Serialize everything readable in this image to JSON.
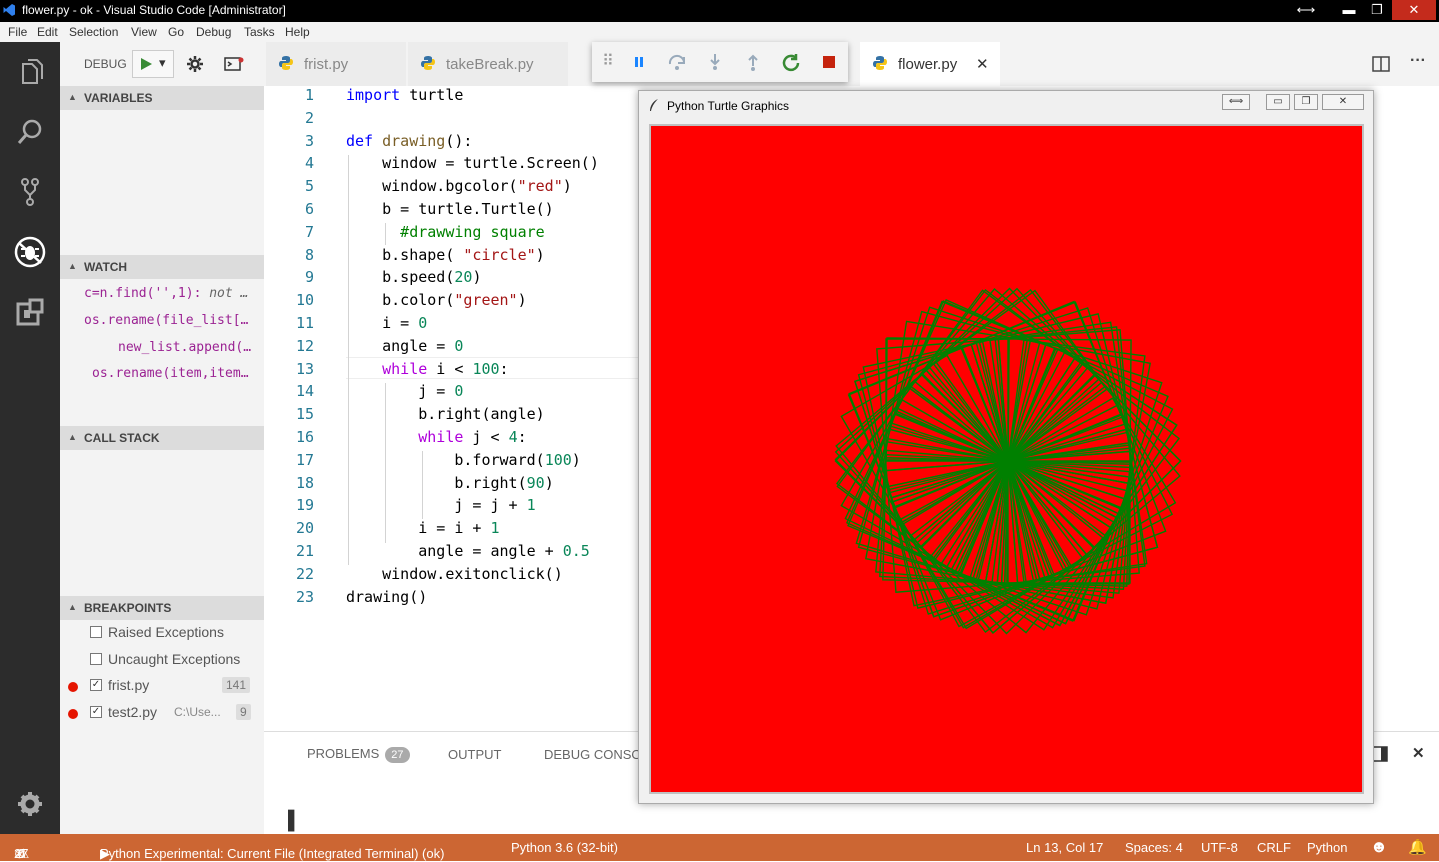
{
  "window": {
    "title": "flower.py - ok - Visual Studio Code [Administrator]",
    "controls": {
      "resize": "⟷",
      "minimize": "▬",
      "maximize": "❐",
      "close": "✕"
    }
  },
  "menu": [
    "File",
    "Edit",
    "Selection",
    "View",
    "Go",
    "Debug",
    "Tasks",
    "Help"
  ],
  "activity_icons": [
    "files-icon",
    "search-icon",
    "source-control-icon",
    "debug-icon",
    "extensions-icon",
    "gear-icon"
  ],
  "debug_header": {
    "label": "DEBUG",
    "config_caret": "▾"
  },
  "sidebar": {
    "variables_title": "VARIABLES",
    "watch_title": "WATCH",
    "watch_items": [
      {
        "expr": "c=n.find('',1): ",
        "value": "not …"
      },
      {
        "expr": "os.rename(file_list[…",
        "value": ""
      },
      {
        "expr": "new_list.append(…",
        "value": ""
      },
      {
        "expr": "os.rename(item,item…",
        "value": ""
      }
    ],
    "callstack_title": "CALL STACK",
    "breakpoints_title": "BREAKPOINTS",
    "breakpoints": [
      {
        "label": "Raised Exceptions",
        "checked": false,
        "dot": false,
        "path": "",
        "line": ""
      },
      {
        "label": "Uncaught Exceptions",
        "checked": false,
        "dot": false,
        "path": "",
        "line": ""
      },
      {
        "label": "frist.py",
        "checked": true,
        "dot": true,
        "path": "",
        "line": "141"
      },
      {
        "label": "test2.py",
        "checked": true,
        "dot": true,
        "path": "C:\\Use...",
        "line": "9"
      }
    ]
  },
  "tabs": [
    {
      "label": "frist.py",
      "active": false
    },
    {
      "label": "takeBreak.py",
      "active": false
    },
    {
      "label": "flower.py",
      "active": true,
      "close": "✕"
    }
  ],
  "editor_actions": {
    "split": "split-editor-icon",
    "more": "···"
  },
  "code_lines": [
    "import turtle",
    "",
    "def drawing():",
    "    window = turtle.Screen()",
    "    window.bgcolor(\"red\")",
    "    b = turtle.Turtle()",
    "      #drawwing square",
    "    b.shape( \"circle\")",
    "    b.speed(20)",
    "    b.color(\"green\")",
    "    i = 0",
    "    angle = 0",
    "    while i < 100:",
    "        j = 0",
    "        b.right(angle)",
    "        while j < 4:",
    "            b.forward(100)",
    "            b.right(90)",
    "            j = j + 1",
    "        i = i + 1",
    "        angle = angle + 0.5",
    "    window.exitonclick()",
    "drawing()"
  ],
  "line_numbers": [
    "1",
    "2",
    "3",
    "4",
    "5",
    "6",
    "7",
    "8",
    "9",
    "10",
    "11",
    "12",
    "13",
    "14",
    "15",
    "16",
    "17",
    "18",
    "19",
    "20",
    "21",
    "22",
    "23"
  ],
  "panel": {
    "tabs": [
      "PROBLEMS",
      "OUTPUT",
      "DEBUG CONSO"
    ],
    "problems_count": "27",
    "cursor": "▌"
  },
  "turtle_window": {
    "title": "Python Turtle Graphics",
    "bgcolor": "#ff0000",
    "pen_color": "#008000",
    "square_count": 100,
    "angle_step_deg": 0.5
  },
  "status": {
    "errors": "27",
    "warnings": "0",
    "launch": "Python Experimental: Current File (Integrated Terminal) (ok)",
    "interpreter": "Python 3.6 (32-bit)",
    "position": "Ln 13, Col 17",
    "spaces": "Spaces: 4",
    "encoding": "UTF-8",
    "eol": "CRLF",
    "language": "Python"
  },
  "colors": {
    "status_bar": "#cc6633",
    "activity_bar": "#2c2c2c"
  }
}
